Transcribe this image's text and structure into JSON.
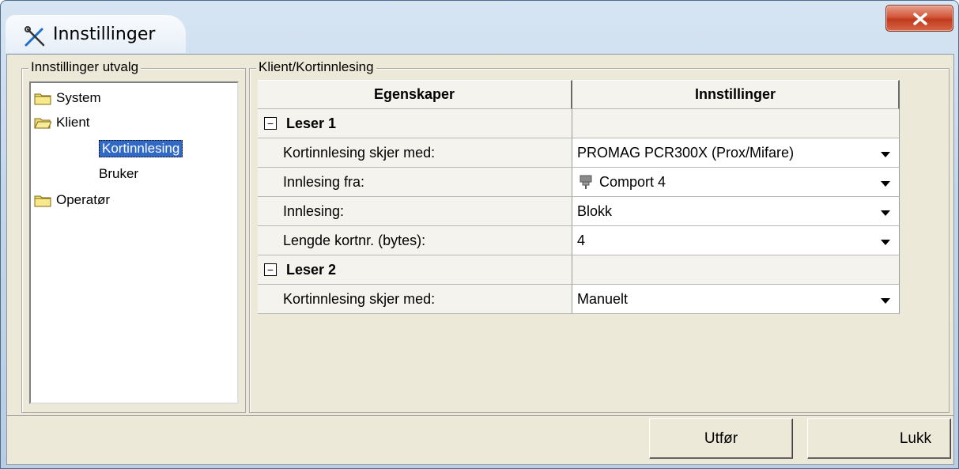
{
  "window": {
    "title": "Innstillinger",
    "close_symbol": "x"
  },
  "left_panel": {
    "legend": "Innstillinger utvalg",
    "tree": [
      {
        "label": "System",
        "type": "folder-closed",
        "level": 0,
        "selected": false
      },
      {
        "label": "Klient",
        "type": "folder-open",
        "level": 0,
        "selected": false
      },
      {
        "label": "Kortinnlesing",
        "type": "leaf",
        "level": 1,
        "selected": true
      },
      {
        "label": "Bruker",
        "type": "leaf",
        "level": 1,
        "selected": false
      },
      {
        "label": "Operatør",
        "type": "folder-closed",
        "level": 0,
        "selected": false
      }
    ]
  },
  "right_panel": {
    "legend": "Klient/Kortinnlesing",
    "grid": {
      "headers": {
        "properties": "Egenskaper",
        "settings": "Innstillinger"
      },
      "groups": [
        {
          "label": "Leser 1",
          "expander": "−",
          "rows": [
            {
              "property": "Kortinnlesing skjer med:",
              "value": "PROMAG PCR300X (Prox/Mifare)",
              "icon": ""
            },
            {
              "property": "Innlesing fra:",
              "value": "Comport 4",
              "icon": "plug-icon"
            },
            {
              "property": "Innlesing:",
              "value": "Blokk",
              "icon": ""
            },
            {
              "property": "Lengde kortnr. (bytes):",
              "value": "4",
              "icon": ""
            }
          ]
        },
        {
          "label": "Leser 2",
          "expander": "−",
          "rows": [
            {
              "property": "Kortinnlesing skjer med:",
              "value": "Manuelt",
              "icon": ""
            }
          ]
        }
      ]
    }
  },
  "buttons": {
    "apply": "Utfør",
    "close": "Lukk"
  }
}
